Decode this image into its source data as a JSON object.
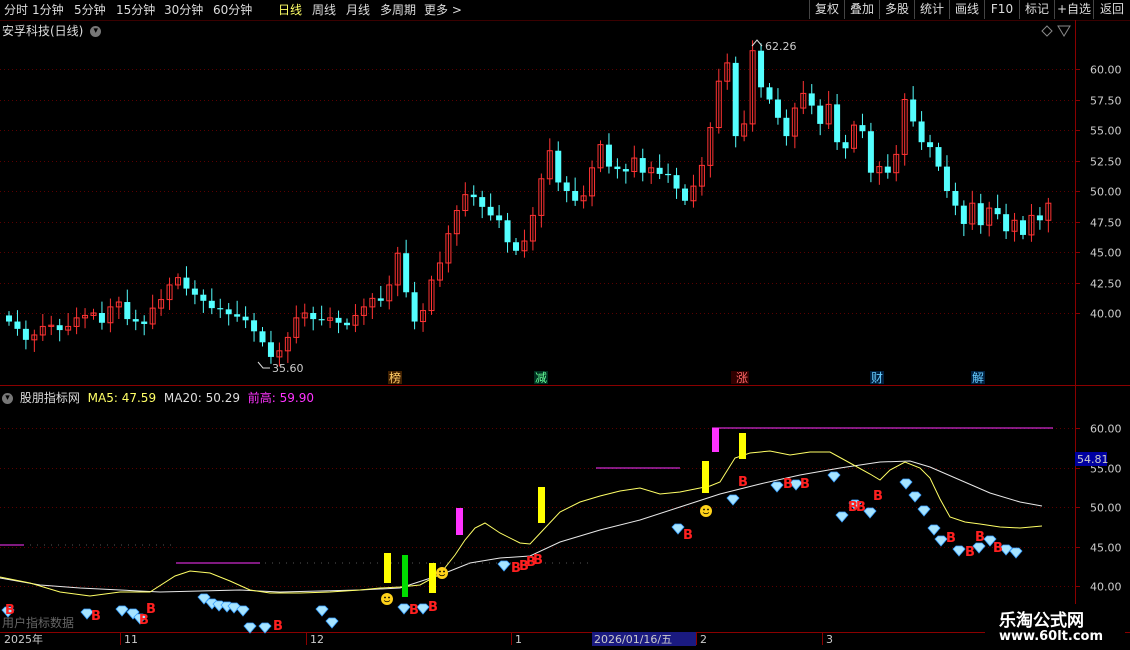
{
  "toolbar": {
    "tabs": [
      "分时",
      "1分钟",
      "5分钟",
      "15分钟",
      "30分钟",
      "60分钟",
      "日线",
      "周线",
      "月线",
      "多周期",
      "更多 >"
    ],
    "active_tab": "日线",
    "right_buttons": [
      "复权",
      "叠加",
      "多股",
      "统计",
      "画线",
      "F10",
      "标记",
      "+自选",
      "返回"
    ]
  },
  "main_panel": {
    "title": "安孚科技(日线)",
    "high_marker": "62.26",
    "low_marker": "35.60",
    "y_ticks": [
      "60.00",
      "57.50",
      "55.00",
      "52.50",
      "50.00",
      "47.50",
      "45.00",
      "42.50",
      "40.00"
    ],
    "event_tags": [
      "榜",
      "减",
      "涨",
      "财",
      "解"
    ]
  },
  "indicator_panel": {
    "name": "股朋指标网",
    "ma5_label": "MA5: 47.59",
    "ma20_label": "MA20: 50.29",
    "prev_high_label": "前高: 59.90",
    "y_ticks": [
      "60.00",
      "55.00",
      "50.00",
      "45.00",
      "40.00"
    ],
    "current_value": "54.81",
    "buy_marker": "B",
    "watermark_faint": "用户指标数据"
  },
  "date_axis": {
    "labels": [
      "2025年",
      "11",
      "12",
      "1",
      "2026/01/16/五",
      "2",
      "3"
    ]
  },
  "watermark": {
    "line1": "乐淘公式网",
    "line2": "www.60lt.com"
  },
  "colors": {
    "up": "#ff3333",
    "down": "#54ffff",
    "grid": "#5a0000",
    "ma5": "#ffff66",
    "ma20": "#e8e8e8",
    "prev_high": "#ff33ff",
    "marker_yellow": "#ffff00",
    "marker_green": "#00dd00",
    "marker_magenta": "#ff33ff"
  },
  "icons": [
    "chevron-down-icon",
    "diamond-icon",
    "smiley-icon",
    "diamond-gem-icon"
  ]
}
